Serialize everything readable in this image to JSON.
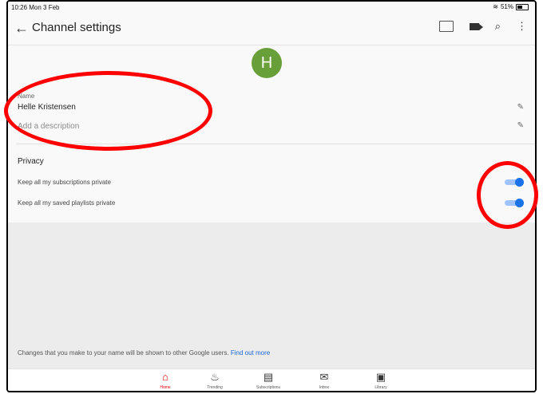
{
  "status": {
    "time": "10:26  Mon 3 Feb",
    "battery": "51%"
  },
  "appbar": {
    "title": "Channel settings"
  },
  "avatar": {
    "letter": "H",
    "color": "#689f38"
  },
  "profile": {
    "name_label": "Name",
    "name_value": "Helle Kristensen",
    "description_placeholder": "Add a description"
  },
  "privacy": {
    "title": "Privacy",
    "items": [
      {
        "label": "Keep all my subscriptions private",
        "enabled": true
      },
      {
        "label": "Keep all my saved playlists private",
        "enabled": true
      }
    ]
  },
  "footer": {
    "note": "Changes that you make to your name will be shown to other Google users.",
    "link": "Find out more"
  },
  "nav": [
    {
      "label": "Home",
      "icon": "home-icon",
      "active": true
    },
    {
      "label": "Trending",
      "icon": "trending-icon",
      "active": false
    },
    {
      "label": "Subscriptions",
      "icon": "subscriptions-icon",
      "active": false
    },
    {
      "label": "Inbox",
      "icon": "inbox-icon",
      "active": false
    },
    {
      "label": "Library",
      "icon": "library-icon",
      "active": false
    }
  ],
  "colors": {
    "accent": "#1a73e8",
    "annotation": "#ff0000",
    "active_nav": "#ee0000"
  }
}
